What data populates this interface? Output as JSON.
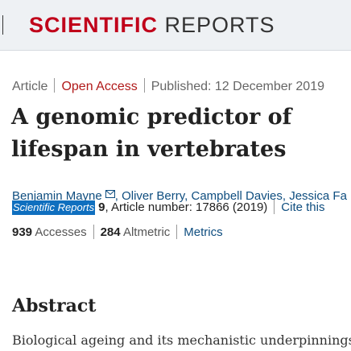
{
  "header": {
    "journal_word1": "SCIENTIFIC",
    "journal_word2": "REPORTS",
    "colors": {
      "brand_red": "#c0001a",
      "background": "#eef1f4"
    }
  },
  "article_meta": {
    "type": "Article",
    "access": "Open Access",
    "published": "Published: 12 December 2019"
  },
  "article": {
    "title": "A genomic predictor of lifespan in vertebrates"
  },
  "authors": {
    "list": [
      {
        "name": "Benjamin Mayne",
        "has_email": true
      },
      {
        "name": "Oliver Berry"
      },
      {
        "name": "Campbell Davies"
      },
      {
        "name": "Jessica Fa"
      }
    ],
    "email_icon": "envelope-icon"
  },
  "citation": {
    "journal": "Scientific Reports",
    "volume": "9",
    "article_number": ", Article number: 17866 (2019)",
    "cite_link": "Cite this"
  },
  "metrics": {
    "accesses_count": "939",
    "accesses_label": "Accesses",
    "altmetric_count": "284",
    "altmetric_label": "Altmetric",
    "metrics_link": "Metrics"
  },
  "abstract": {
    "heading": "Abstract",
    "text": "Biological ageing and its mechanistic underpinnings"
  }
}
